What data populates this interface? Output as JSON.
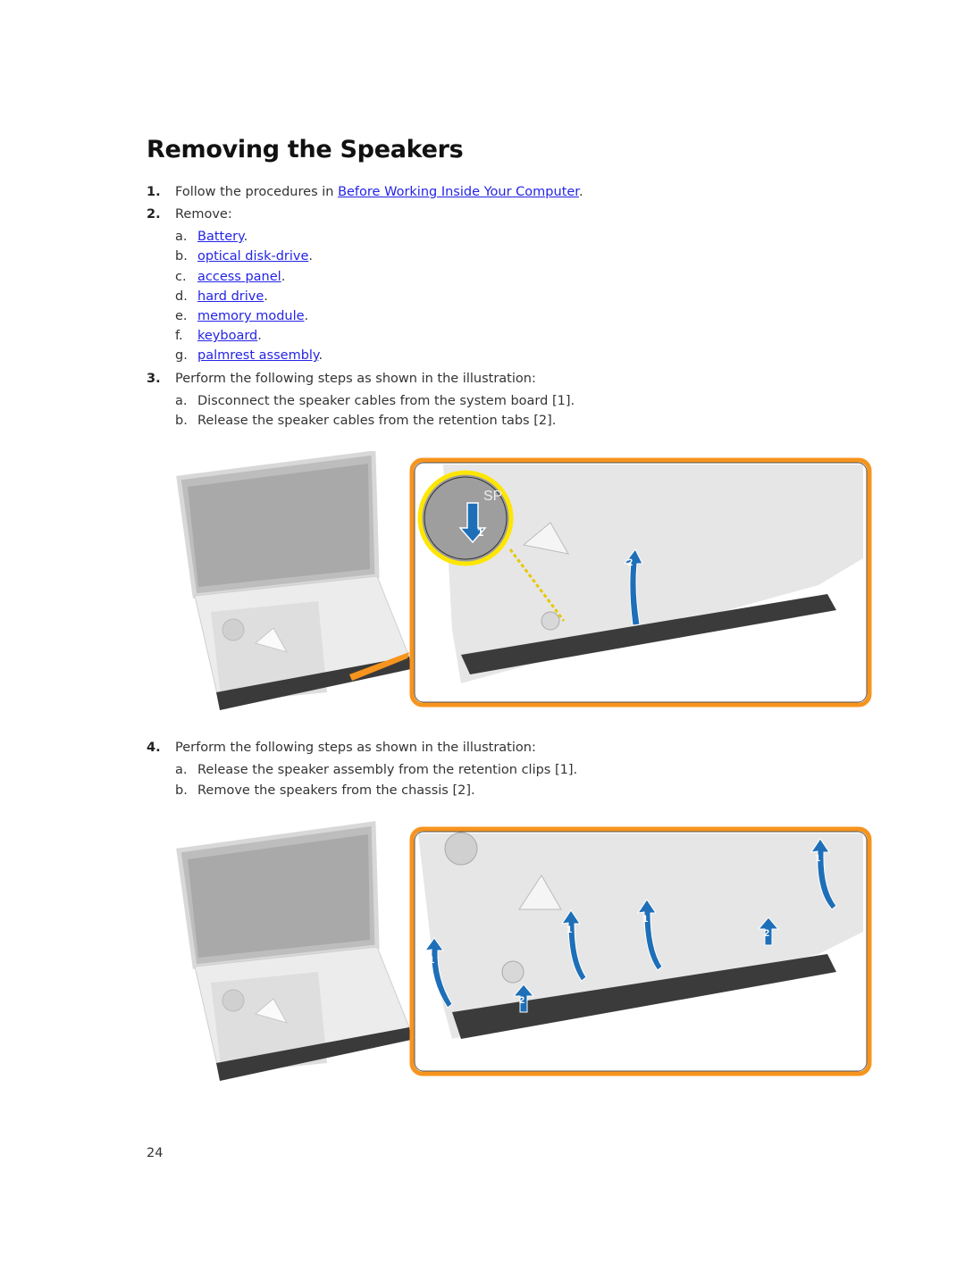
{
  "page": {
    "title": "Removing the Speakers",
    "page_number": "24"
  },
  "steps": [
    {
      "number": "1.",
      "text_before": "Follow the procedures in ",
      "link": "Before Working Inside Your Computer",
      "text_after": "."
    },
    {
      "number": "2.",
      "text": "Remove:",
      "items": [
        {
          "letter": "a.",
          "link": "Battery",
          "suffix": "."
        },
        {
          "letter": "b.",
          "link": "optical disk-drive",
          "suffix": "."
        },
        {
          "letter": "c.",
          "link": "access panel",
          "suffix": "."
        },
        {
          "letter": "d.",
          "link": "hard drive",
          "suffix": "."
        },
        {
          "letter": "e.",
          "link": "memory module",
          "suffix": "."
        },
        {
          "letter": "f.",
          "link": "keyboard",
          "suffix": "."
        },
        {
          "letter": "g.",
          "link": "palmrest assembly",
          "suffix": "."
        }
      ]
    },
    {
      "number": "3.",
      "text": "Perform the following steps as shown in the illustration:",
      "items": [
        {
          "letter": "a.",
          "text": "Disconnect the speaker cables from the system board [1]."
        },
        {
          "letter": "b.",
          "text": "Release the speaker cables from the retention tabs [2]."
        }
      ]
    },
    {
      "number": "4.",
      "text": "Perform the following steps as shown in the illustration:",
      "items": [
        {
          "letter": "a.",
          "text": "Release the speaker assembly from the retention clips [1]."
        },
        {
          "letter": "b.",
          "text": "Remove the speakers from the chassis [2]."
        }
      ]
    }
  ],
  "figures": [
    {
      "callouts": [
        "1",
        "2"
      ],
      "inset_label": "SP"
    },
    {
      "callouts": [
        "1",
        "1",
        "1",
        "1",
        "2",
        "2"
      ]
    }
  ],
  "colors": {
    "link": "#2424e6",
    "frame": "#f7941d",
    "arrow": "#1e6fb8",
    "inset_ring": "#ffe600"
  }
}
